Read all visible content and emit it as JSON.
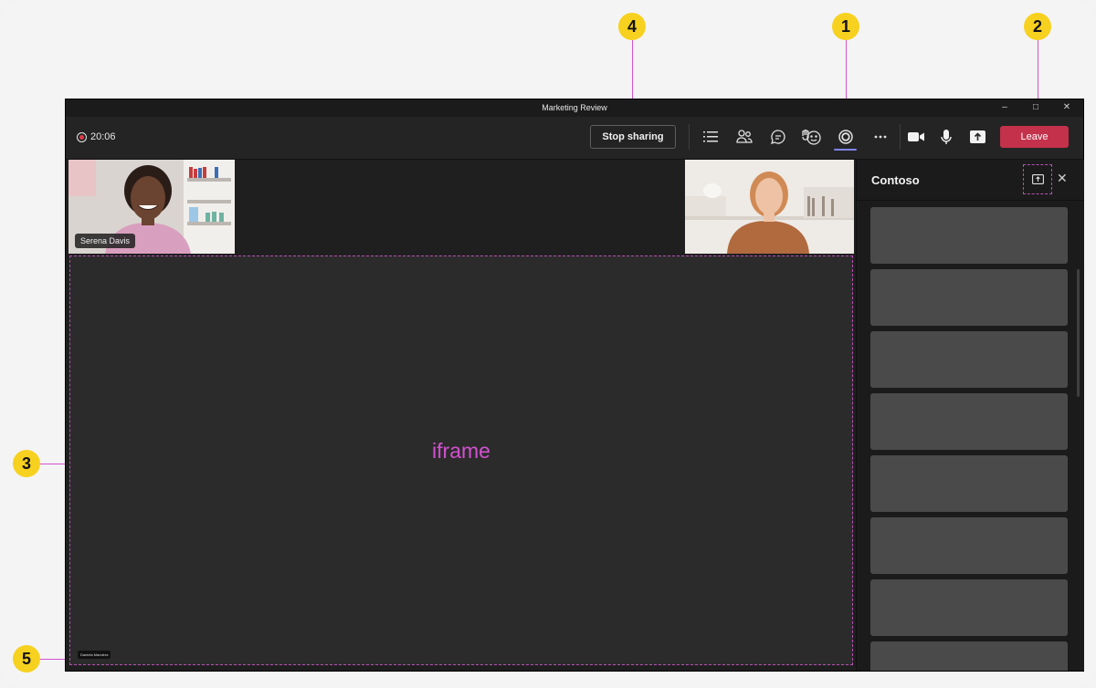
{
  "window": {
    "title": "Marketing Review"
  },
  "titlebar": {
    "minimize_icon": "–",
    "maximize_icon": "□",
    "close_icon": "✕"
  },
  "toolbar": {
    "timer": "20:06",
    "stop_sharing_label": "Stop sharing",
    "leave_label": "Leave",
    "icons": [
      "list-icon",
      "people-icon",
      "chat-icon",
      "react-icon",
      "apps-icon",
      "more-icon",
      "camera-icon",
      "mic-icon",
      "share-icon"
    ]
  },
  "participants": [
    {
      "name": "Serena Davis"
    },
    {
      "name": ""
    }
  ],
  "stage": {
    "iframe_label": "iframe",
    "presenter_name": "Daniela Mandera"
  },
  "side_panel": {
    "title": "Contoso",
    "close_icon": "✕",
    "card_count_visible": 8
  },
  "callouts": [
    "1",
    "2",
    "3",
    "4",
    "5"
  ],
  "colors": {
    "accent": "#d351d0",
    "leave": "#c4314b",
    "callout": "#f7d11f"
  }
}
